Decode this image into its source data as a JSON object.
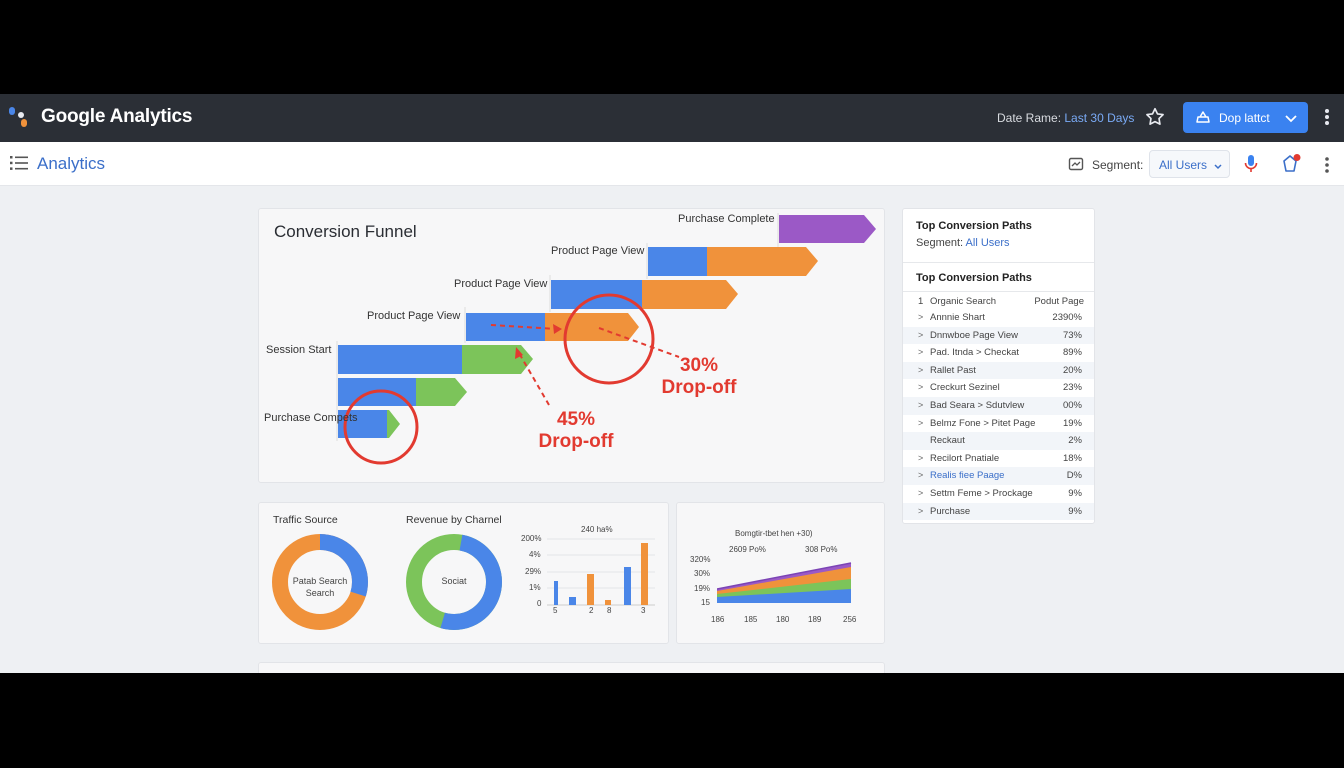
{
  "header": {
    "app_title": "Google Analytics",
    "date_range_label": "Date Rame:",
    "date_range_value": "Last 30 Days",
    "dropdown_label": "Dop lattct"
  },
  "subheader": {
    "title": "Analytics",
    "segment_label": "Segment:",
    "segment_value": "All Users"
  },
  "funnel": {
    "title": "Conversion Funnel",
    "stage_labels": [
      "Purchase Complete",
      "Product Page View",
      "Product Page View",
      "Product Page View",
      "Session Start",
      "Purchase Compets"
    ],
    "drop_offs": [
      {
        "percent": "30%",
        "label": "Drop-off"
      },
      {
        "percent": "45%",
        "label": "Drop-off"
      }
    ]
  },
  "paths": {
    "title": "Top Conversion Paths",
    "segment_label": "Segment:",
    "segment_value": "All Users",
    "subtitle": "Top Conversion Paths",
    "header": {
      "index": "1",
      "left": "Organic Search",
      "right": "Podut Page"
    },
    "rows": [
      {
        "chevron": ">",
        "name": "Annnie Shart",
        "pct": "2390%"
      },
      {
        "chevron": ">",
        "name": "Dnnwboe Page View",
        "pct": "73%"
      },
      {
        "chevron": ">",
        "name": "Pad. Itnda > Checkat",
        "pct": "89%"
      },
      {
        "chevron": ">",
        "name": "Rallet Past",
        "pct": "20%"
      },
      {
        "chevron": ">",
        "name": "Creckurt Sezinel",
        "pct": "23%"
      },
      {
        "chevron": ">",
        "name": "Bad Seara > Sdutvlew",
        "pct": "00%"
      },
      {
        "chevron": ">",
        "name": "Belmz Fone > Pitet Page",
        "pct": "19%"
      },
      {
        "chevron": "",
        "name": "Reckaut",
        "pct": "2%"
      },
      {
        "chevron": ">",
        "name": "Recilort Pnatiale",
        "pct": "18%"
      },
      {
        "chevron": ">",
        "name": "Realis fiee Paage",
        "pct": "D%"
      },
      {
        "chevron": ">",
        "name": "Settm Feme > Prockage",
        "pct": "9%"
      },
      {
        "chevron": ">",
        "name": "Purchase",
        "pct": "9%"
      }
    ]
  },
  "traffic": {
    "title": "Traffic Source",
    "donut_label_line1": "Patab Search",
    "donut_label_line2": "Search"
  },
  "revenue": {
    "title": "Revenue by Charnel",
    "donut_label": "Sociat",
    "bar_title": "240 ha%",
    "y_ticks": [
      "200%",
      "4%",
      "29%",
      "1%",
      "0"
    ],
    "x_ticks": [
      "5",
      "2",
      "8",
      "3"
    ]
  },
  "area_chart": {
    "title": "Bomgtir-tbet hen +30)",
    "sub_left": "2609 Po%",
    "sub_right": "308 Po%",
    "y_ticks": [
      "320%",
      "30%",
      "19%",
      "15"
    ],
    "x_ticks": [
      "186",
      "185",
      "180",
      "189",
      "256"
    ]
  },
  "colors": {
    "blue": "#4a86e8",
    "orange": "#f0923b",
    "green": "#7cc45a",
    "purple": "#9b59c6",
    "red": "#e23a30",
    "header_bg": "#2b2f36"
  },
  "icons": [
    "logo-icon",
    "star-icon",
    "drive-icon",
    "chevron-down-icon",
    "more-vert-icon",
    "menu-icon",
    "segment-icon",
    "mic-icon",
    "notification-icon"
  ]
}
